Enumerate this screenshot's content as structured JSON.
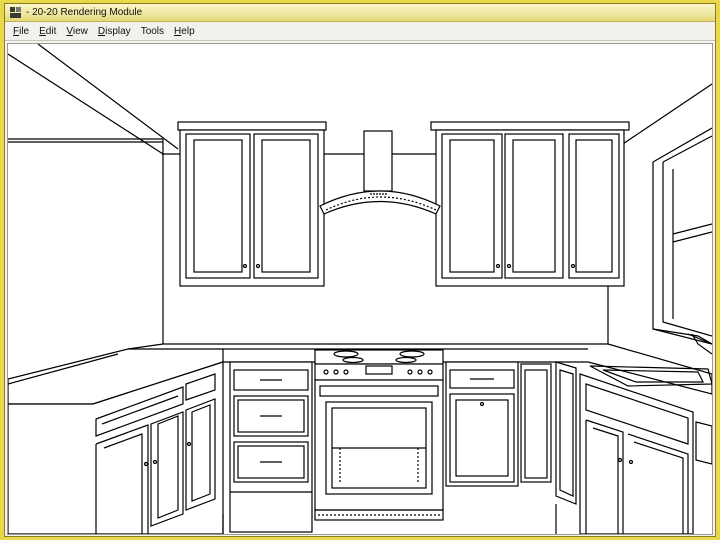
{
  "window": {
    "title": "- 20-20 Rendering Module",
    "icon": "app-icon"
  },
  "menu": [
    {
      "label": "File",
      "accel": "F",
      "rest": "ile"
    },
    {
      "label": "Edit",
      "accel": "E",
      "rest": "dit"
    },
    {
      "label": "View",
      "accel": "V",
      "rest": "iew"
    },
    {
      "label": "Display",
      "accel": "D",
      "rest": "isplay"
    },
    {
      "label": "Tools",
      "accel": "",
      "rest": "Tools"
    },
    {
      "label": "Help",
      "accel": "H",
      "rest": "elp"
    }
  ],
  "rendering": {
    "subject": "kitchen-line-drawing",
    "colors": {
      "line": "#000000",
      "background": "#ffffff",
      "frame": "#e8d84a"
    }
  }
}
